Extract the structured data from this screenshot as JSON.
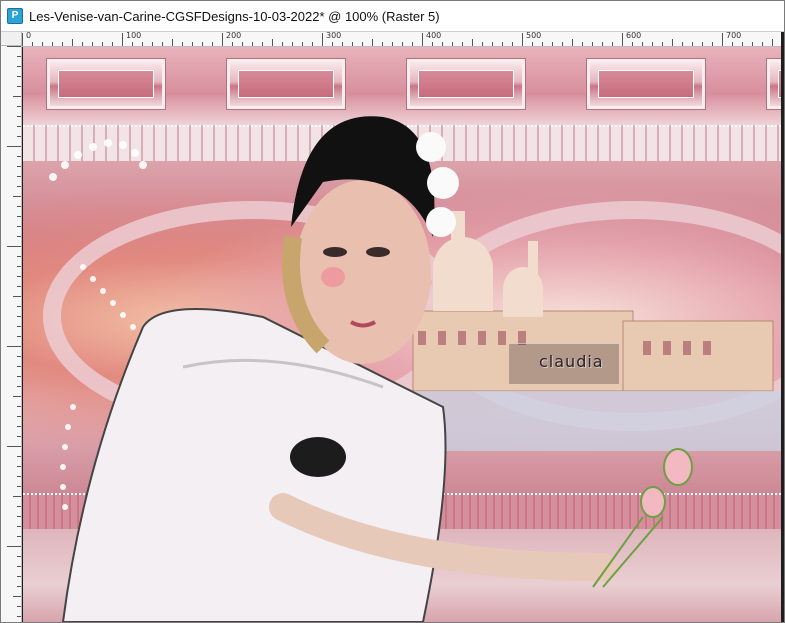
{
  "window": {
    "title": "Les-Venise-van-Carine-CGSFDesigns-10-03-2022* @ 100% (Raster 5)",
    "icon": "psp-document-icon"
  },
  "ruler": {
    "labels": [
      "0",
      "100",
      "200",
      "300",
      "400",
      "500",
      "600",
      "700"
    ]
  },
  "canvas": {
    "watermark": "claudia"
  },
  "colors": {
    "title_bg": "#ffffff",
    "canvas_accent": "#d48f9b"
  }
}
